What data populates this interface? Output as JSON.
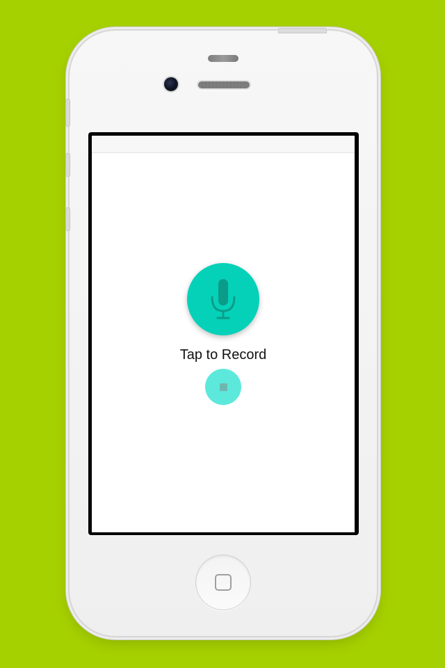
{
  "background_color": "#a6d100",
  "accent_color": "#05d1b9",
  "stop_color": "#5de8dc",
  "phone": {
    "model": "iPhone",
    "color": "white"
  },
  "app": {
    "record_label": "Tap to Record",
    "record_icon": "microphone-icon",
    "stop_icon": "stop-icon"
  }
}
